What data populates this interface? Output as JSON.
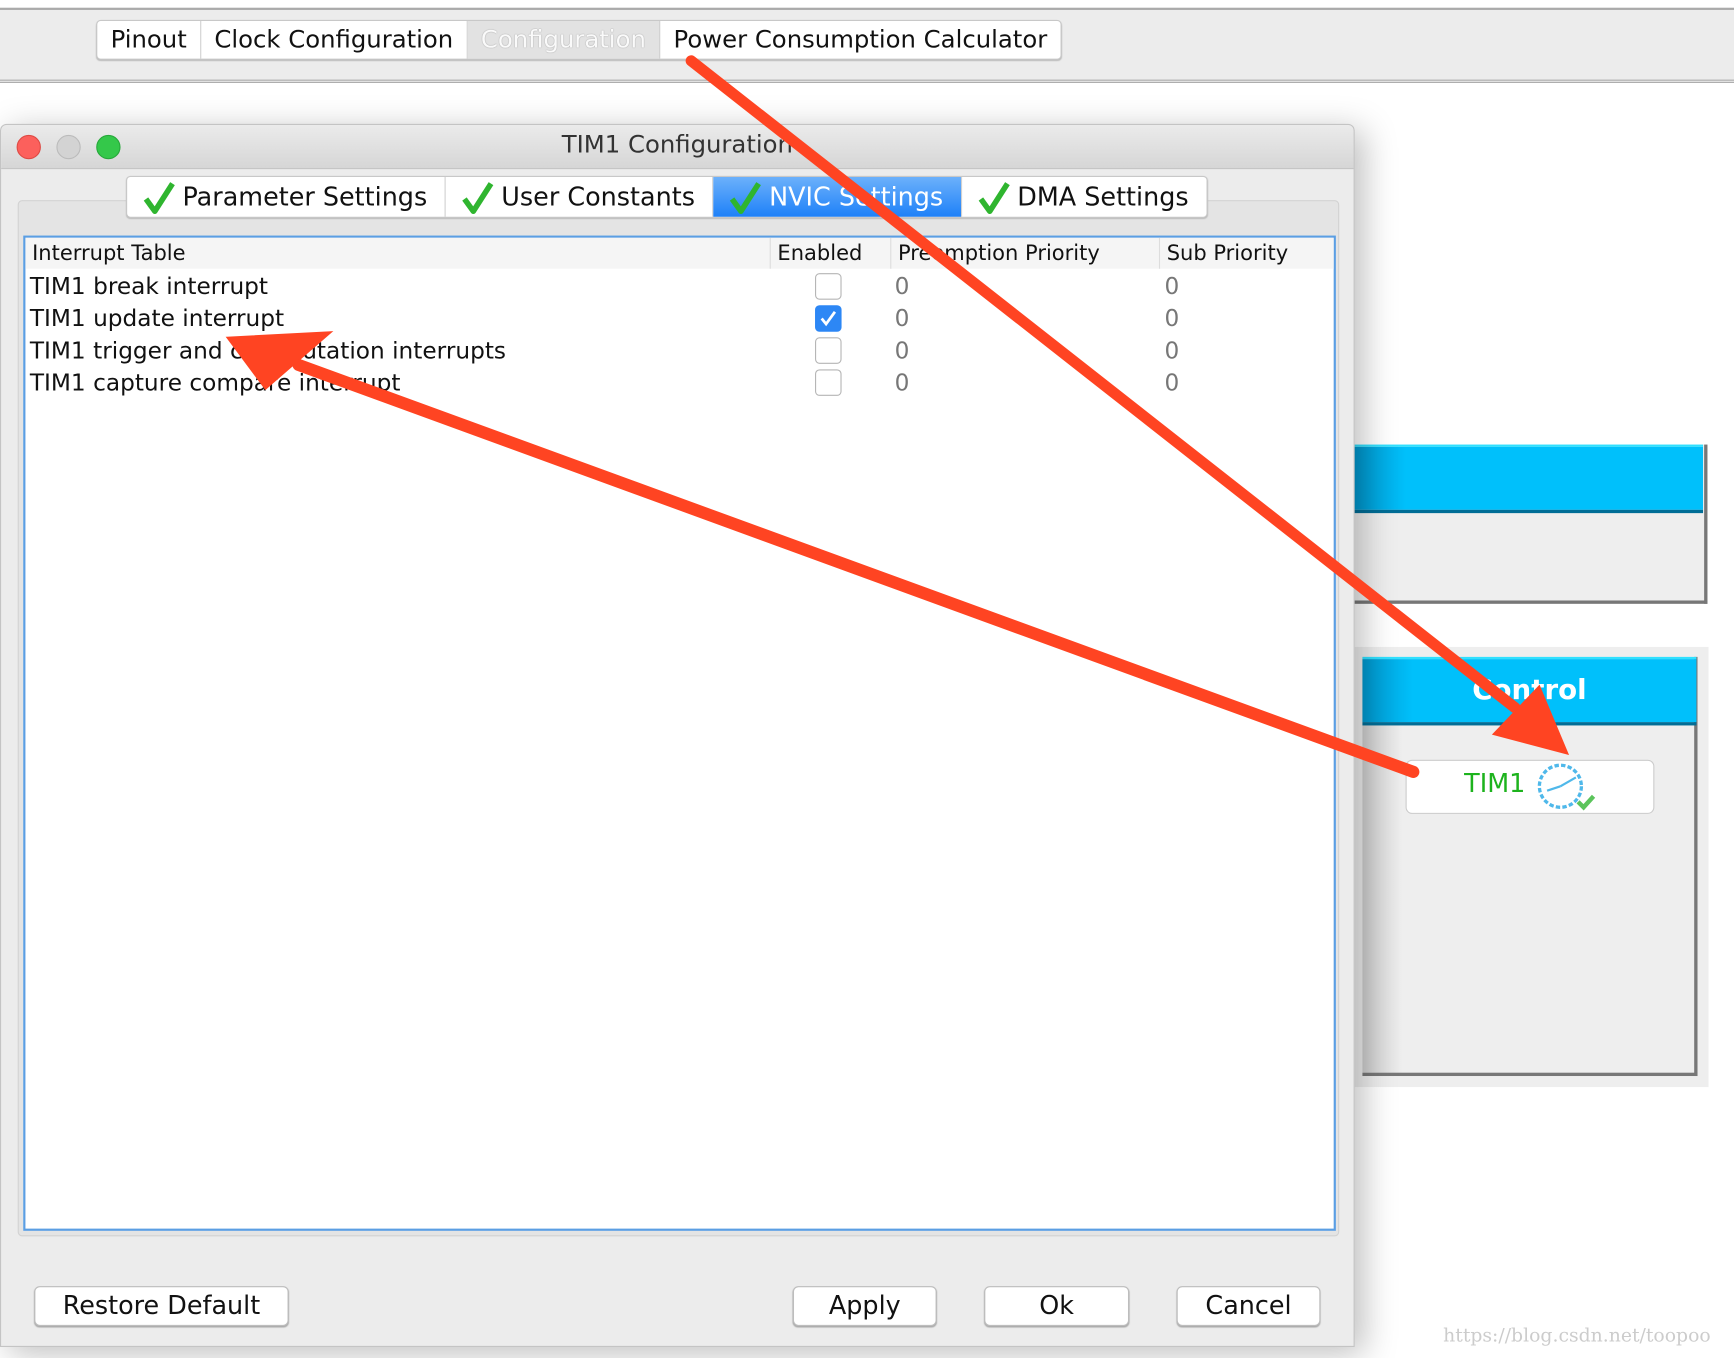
{
  "main_tabs": [
    {
      "label": "Pinout"
    },
    {
      "label": "Clock Configuration"
    },
    {
      "label": "Configuration"
    },
    {
      "label": "Power Consumption Calculator"
    }
  ],
  "dialog": {
    "title": "TIM1 Configuration",
    "tabs": [
      {
        "label": "Parameter Settings"
      },
      {
        "label": "User Constants"
      },
      {
        "label": "NVIC Settings"
      },
      {
        "label": "DMA Settings"
      }
    ],
    "active_tab": "NVIC Settings",
    "table": {
      "columns": [
        "Interrupt Table",
        "Enabled",
        "Preemption Priority",
        "Sub Priority"
      ],
      "rows": [
        {
          "name": "TIM1 break interrupt",
          "enabled": false,
          "preemption": "0",
          "sub": "0"
        },
        {
          "name": "TIM1 update interrupt",
          "enabled": true,
          "preemption": "0",
          "sub": "0"
        },
        {
          "name": "TIM1 trigger and commutation interrupts",
          "enabled": false,
          "preemption": "0",
          "sub": "0"
        },
        {
          "name": "TIM1 capture compare interrupt",
          "enabled": false,
          "preemption": "0",
          "sub": "0"
        }
      ]
    },
    "buttons": {
      "restore": "Restore Default",
      "apply": "Apply",
      "ok": "Ok",
      "cancel": "Cancel"
    }
  },
  "background": {
    "control_header": "Control",
    "tim1_button": "TIM1"
  },
  "watermark": "https://blog.csdn.net/toopoo",
  "colors": {
    "accent": "#1a7ef8",
    "arrow": "#ff4422",
    "header_blue": "#00c0fb",
    "tim_green": "#1db31d"
  }
}
